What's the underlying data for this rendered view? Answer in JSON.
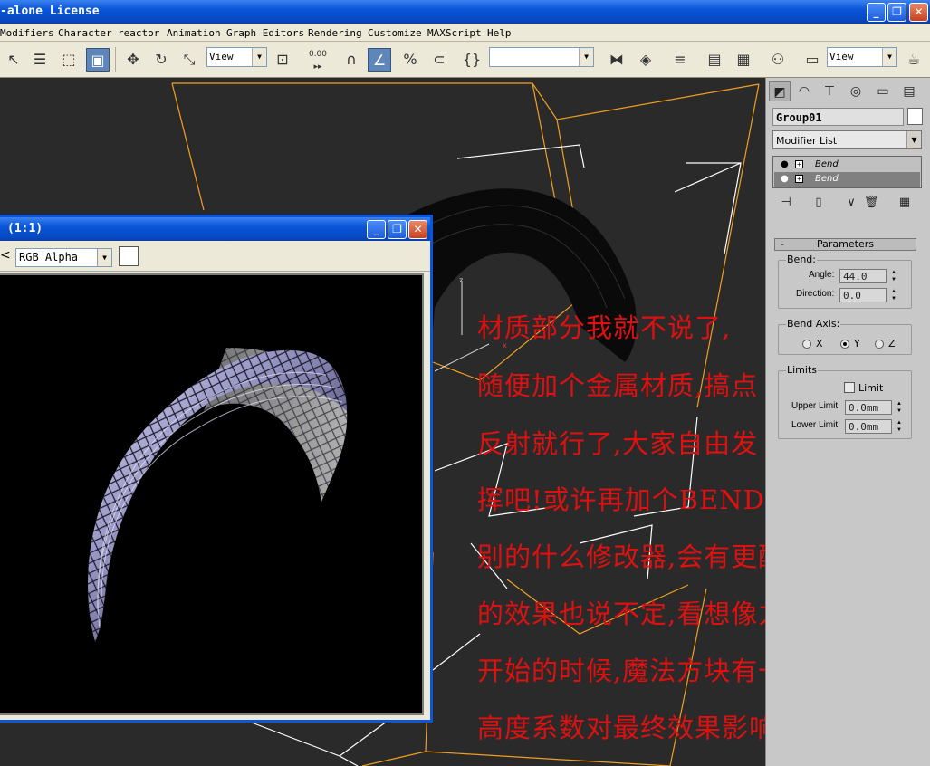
{
  "window": {
    "title": "-alone License",
    "controls": [
      "_",
      "❐",
      "✕"
    ]
  },
  "menu": [
    "Modifiers",
    "Character",
    "reactor",
    "Animation",
    "Graph Editors",
    "Rendering",
    "Customize",
    "MAXScript",
    "Help"
  ],
  "toolbar": {
    "view_combo_1": "View",
    "spinner_snap_value": "0.00",
    "view_combo_2": "View"
  },
  "cmd_panel": {
    "object_name": "Group01",
    "modifier_list": "Modifier List",
    "stack": [
      {
        "name": "Bend",
        "selected": false
      },
      {
        "name": "Bend",
        "selected": true
      }
    ],
    "rollout_title": "Parameters",
    "bend_group": "Bend:",
    "angle_label": "Angle:",
    "angle_value": "44.0",
    "direction_label": "Direction:",
    "direction_value": "0.0",
    "axis_group": "Bend Axis:",
    "axis_x": "X",
    "axis_y": "Y",
    "axis_z": "Z",
    "selected_axis": "Y",
    "limits_group": "Limits",
    "limit_label": "Limit",
    "limit_checked": false,
    "upper_label": "Upper Limit:",
    "upper_value": "0.0mm",
    "lower_label": "Lower Limit:",
    "lower_value": "0.0mm"
  },
  "render_window": {
    "title": "(1:1)",
    "channel": "RGB Alpha"
  },
  "annotation": {
    "color": "#e01010",
    "lines": [
      "材质部分我就不说了,",
      "随便加个金属材质,搞点",
      "反射就行了,大家自由发",
      "挥吧!或许再加个BEND或",
      "别的什么修改器,会有更酷",
      "的效果也说不定,看想像力啦!",
      "开始的时候,魔法方块有一个",
      "高度系数对最终效果影响很大!"
    ]
  }
}
